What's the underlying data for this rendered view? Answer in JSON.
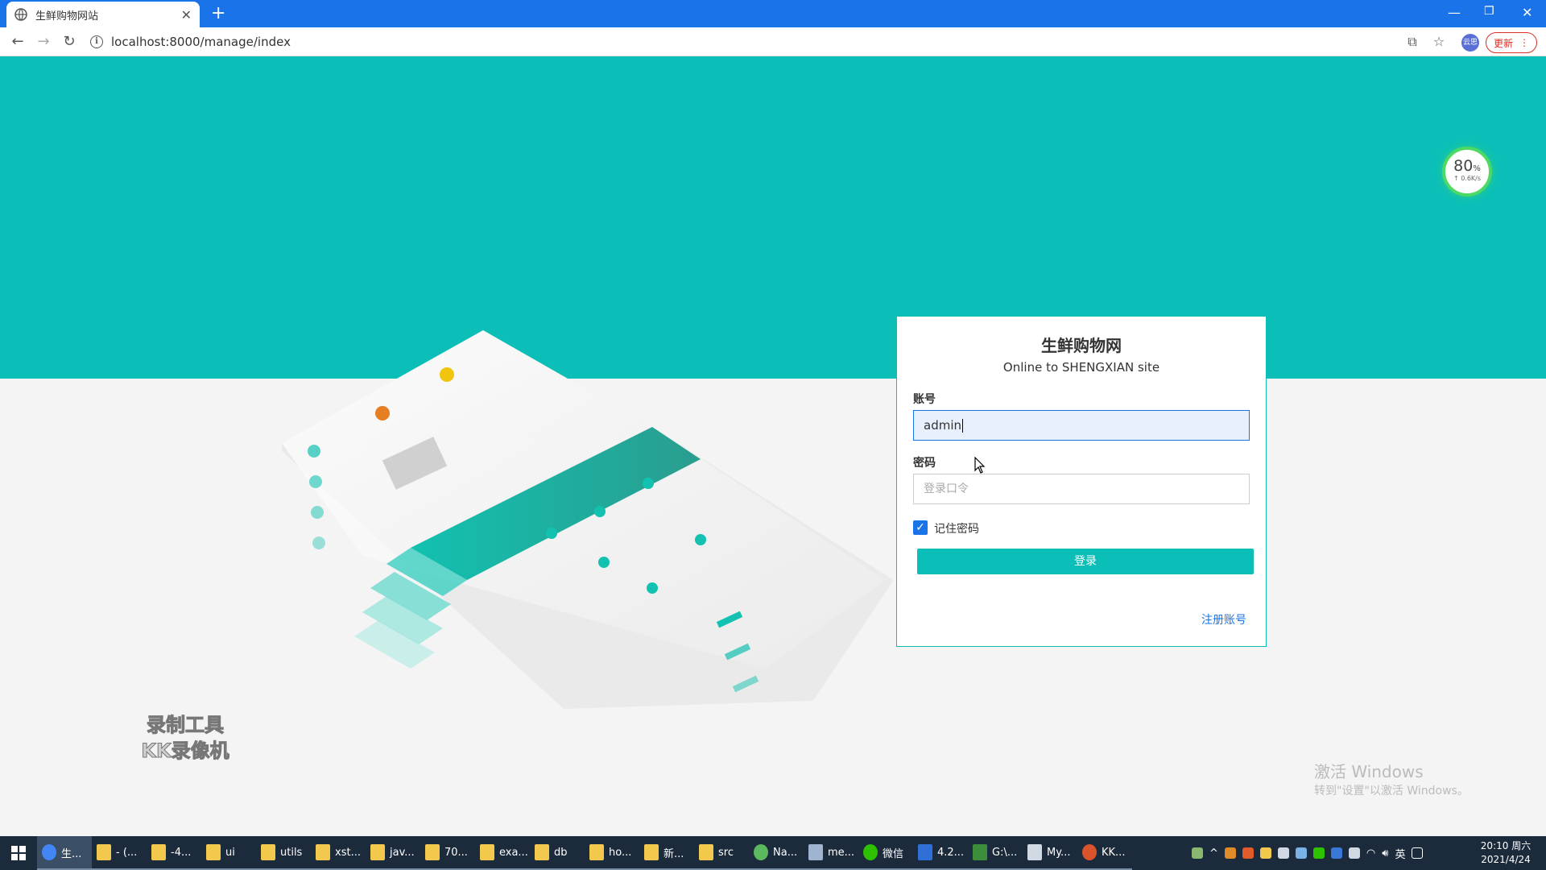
{
  "browser": {
    "tab_title": "生鲜购物网站",
    "url": "localhost:8000/manage/index",
    "profile_label": "云思",
    "update_label": "更新"
  },
  "login": {
    "title": "生鲜购物网",
    "subtitle": "Online to SHENGXIAN site",
    "account_label": "账号",
    "account_value": "admin",
    "password_label": "密码",
    "password_placeholder": "登录口令",
    "remember_label": "记住密码",
    "remember_checked": true,
    "submit_label": "登录",
    "register_label": "注册账号"
  },
  "network_widget": {
    "percent": "80",
    "percent_unit": "%",
    "speed": "↑ 0.6K/s"
  },
  "watermark": {
    "line1": "录制工具",
    "line2": "KK录像机"
  },
  "activation_notice": {
    "title": "激活 Windows",
    "subtitle": "转到\"设置\"以激活 Windows。"
  },
  "taskbar": {
    "items": [
      {
        "label": "生...",
        "icon_color": "#4285f4",
        "icon": "chrome-icon"
      },
      {
        "label": "- (...",
        "icon_color": "#f2c94c",
        "icon": "folder-icon"
      },
      {
        "label": "-4...",
        "icon_color": "#f2c94c",
        "icon": "folder-icon"
      },
      {
        "label": "ui",
        "icon_color": "#f2c94c",
        "icon": "folder-icon"
      },
      {
        "label": "utils",
        "icon_color": "#f2c94c",
        "icon": "folder-icon"
      },
      {
        "label": "xst...",
        "icon_color": "#f2c94c",
        "icon": "folder-icon"
      },
      {
        "label": "jav...",
        "icon_color": "#f2c94c",
        "icon": "folder-icon"
      },
      {
        "label": "70...",
        "icon_color": "#f2c94c",
        "icon": "folder-icon"
      },
      {
        "label": "exa...",
        "icon_color": "#f2c94c",
        "icon": "folder-icon"
      },
      {
        "label": "db",
        "icon_color": "#f2c94c",
        "icon": "folder-icon"
      },
      {
        "label": "ho...",
        "icon_color": "#f2c94c",
        "icon": "folder-icon"
      },
      {
        "label": "新...",
        "icon_color": "#f2c94c",
        "icon": "folder-icon"
      },
      {
        "label": "src",
        "icon_color": "#f2c94c",
        "icon": "folder-icon"
      },
      {
        "label": "Na...",
        "icon_color": "#5cb85c",
        "icon": "navicat-icon"
      },
      {
        "label": "me...",
        "icon_color": "#9fb4d1",
        "icon": "notepad-icon"
      },
      {
        "label": "微信",
        "icon_color": "#2dc100",
        "icon": "wechat-icon"
      },
      {
        "label": "4.2...",
        "icon_color": "#2f6fd6",
        "icon": "vscode-icon"
      },
      {
        "label": "G:\\...",
        "icon_color": "#3c8d3c",
        "icon": "excel-icon"
      },
      {
        "label": "My...",
        "icon_color": "#cfd8e3",
        "icon": "pen-icon"
      },
      {
        "label": "KK...",
        "icon_color": "#d9542b",
        "icon": "recorder-icon"
      }
    ],
    "ime_label": "英",
    "clock_time": "20:10 周六",
    "clock_date": "2021/4/24"
  },
  "colors": {
    "teal": "#0bbfb8",
    "chrome_blue": "#1a73e8",
    "taskbar": "#1c2b3c"
  }
}
